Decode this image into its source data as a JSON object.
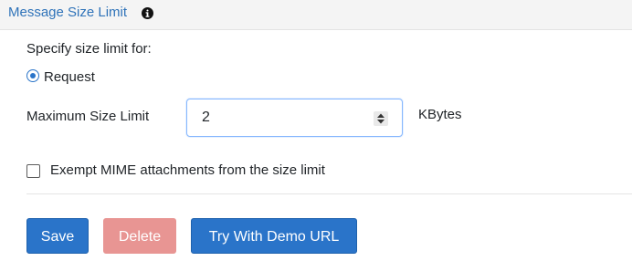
{
  "header": {
    "title": "Message Size Limit",
    "info_icon": "info-circle-icon"
  },
  "form": {
    "specify_label": "Specify size limit for:",
    "radio_option": {
      "label": "Request",
      "selected": true
    },
    "max_size_label": "Maximum Size Limit",
    "max_size_value": "2",
    "unit_label": "KBytes",
    "exempt_checkbox": {
      "label": "Exempt MIME attachments from the size limit",
      "checked": false
    }
  },
  "actions": {
    "save_label": "Save",
    "delete_label": "Delete",
    "demo_label": "Try With Demo URL"
  },
  "colors": {
    "primary": "#2a74c9",
    "danger_disabled": "#e89593",
    "link": "#2f73b9"
  }
}
